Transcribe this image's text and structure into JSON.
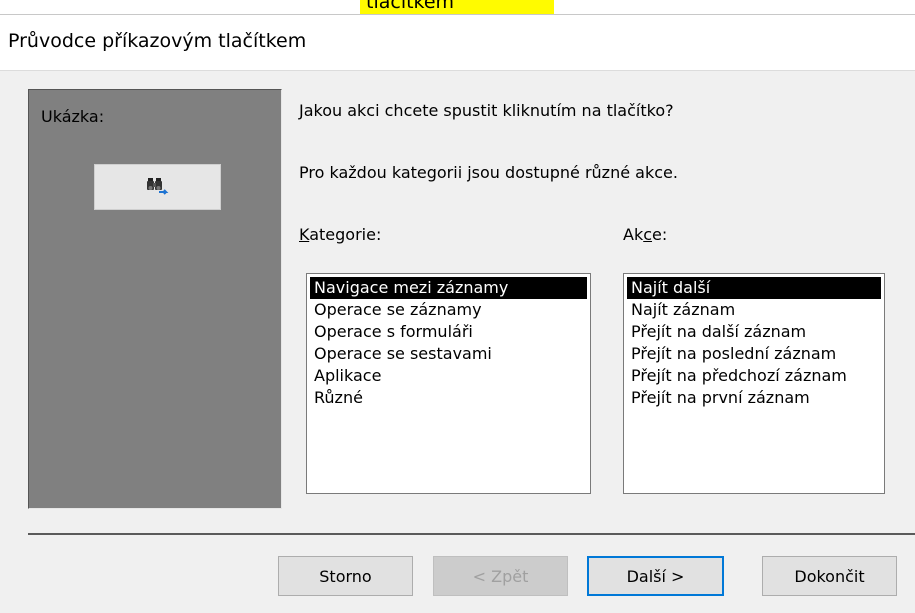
{
  "top_fragment": {
    "text": "tlačítkem"
  },
  "dialog": {
    "title": "Průvodce příkazovým tlačítkem"
  },
  "preview": {
    "label": "Ukázka:",
    "icon": "binoculars-icon"
  },
  "prompt": {
    "question": "Jakou akci chcete spustit kliknutím na tlačítko?",
    "info": "Pro každou kategorii jsou dostupné různé akce."
  },
  "categories": {
    "label": "Kategorie:",
    "items": [
      "Navigace mezi záznamy",
      "Operace se záznamy",
      "Operace s formuláři",
      "Operace se sestavami",
      "Aplikace",
      "Různé"
    ],
    "selected_index": 0
  },
  "actions": {
    "label": "Akce:",
    "items": [
      "Najít další",
      "Najít záznam",
      "Přejít na další záznam",
      "Přejít na poslední záznam",
      "Přejít na předchozí záznam",
      "Přejít na první záznam"
    ],
    "selected_index": 0
  },
  "buttons": {
    "cancel": "Storno",
    "back": "< Zpět",
    "next": "Další >",
    "finish": "Dokončit"
  },
  "colors": {
    "preview_bg": "#808080",
    "selection_bg": "#000000",
    "default_button_border": "#0078d7"
  }
}
